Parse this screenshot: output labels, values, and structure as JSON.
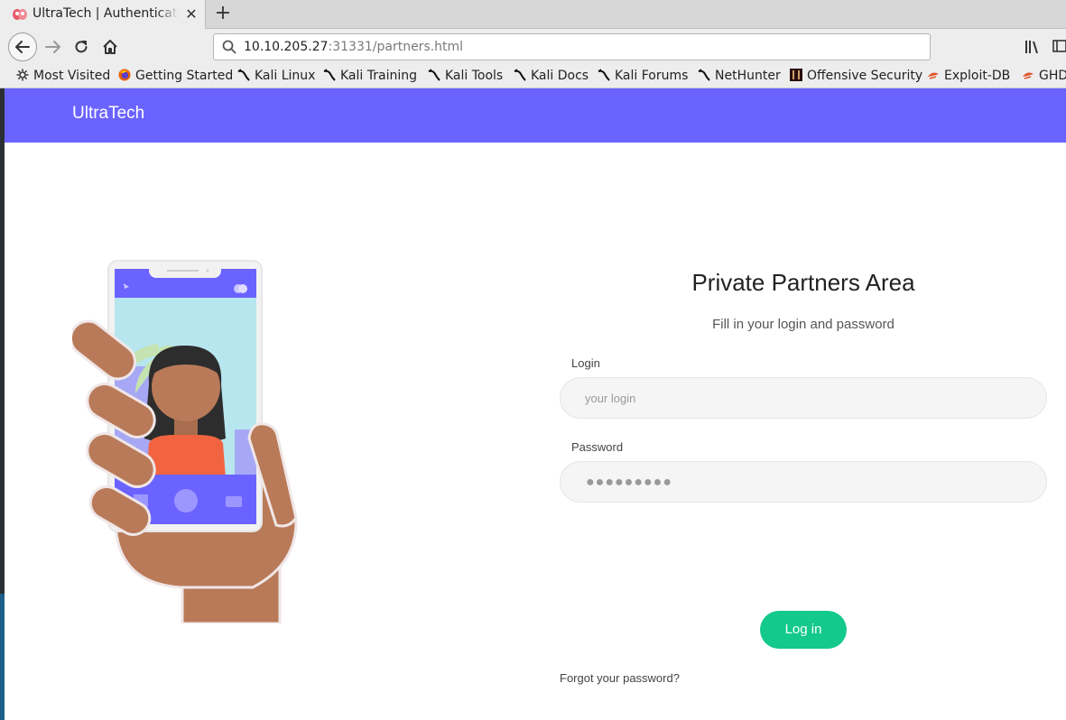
{
  "browser": {
    "tab_title": "UltraTech | Authentication",
    "tab_close": "✕",
    "new_tab": "+",
    "url_host": "10.10.205.27",
    "url_rest": ":31331/partners.html",
    "bookmarks": [
      {
        "label": "Most Visited",
        "icon": "gear-icon"
      },
      {
        "label": "Getting Started",
        "icon": "firefox-icon"
      },
      {
        "label": "Kali Linux",
        "icon": "kali-dragon-icon"
      },
      {
        "label": "Kali Training",
        "icon": "kali-dragon-icon"
      },
      {
        "label": "Kali Tools",
        "icon": "kali-dragon-icon"
      },
      {
        "label": "Kali Docs",
        "icon": "kali-dragon-icon"
      },
      {
        "label": "Kali Forums",
        "icon": "kali-dragon-icon"
      },
      {
        "label": "NetHunter",
        "icon": "kali-dragon-icon"
      },
      {
        "label": "Offensive Security",
        "icon": "offsec-icon"
      },
      {
        "label": "Exploit-DB",
        "icon": "exploitdb-icon"
      },
      {
        "label": "GHD",
        "icon": "exploitdb-icon"
      }
    ]
  },
  "site": {
    "logo": "UltraTech",
    "accent": "#6b63ff"
  },
  "login": {
    "title": "Private Partners Area",
    "subtitle": "Fill in your login and password",
    "login_label": "Login",
    "login_placeholder": "your login",
    "password_label": "Password",
    "password_mask": "●●●●●●●●●",
    "submit": "Log in",
    "submit_color": "#13c98b",
    "forgot": "Forgot your password?"
  }
}
